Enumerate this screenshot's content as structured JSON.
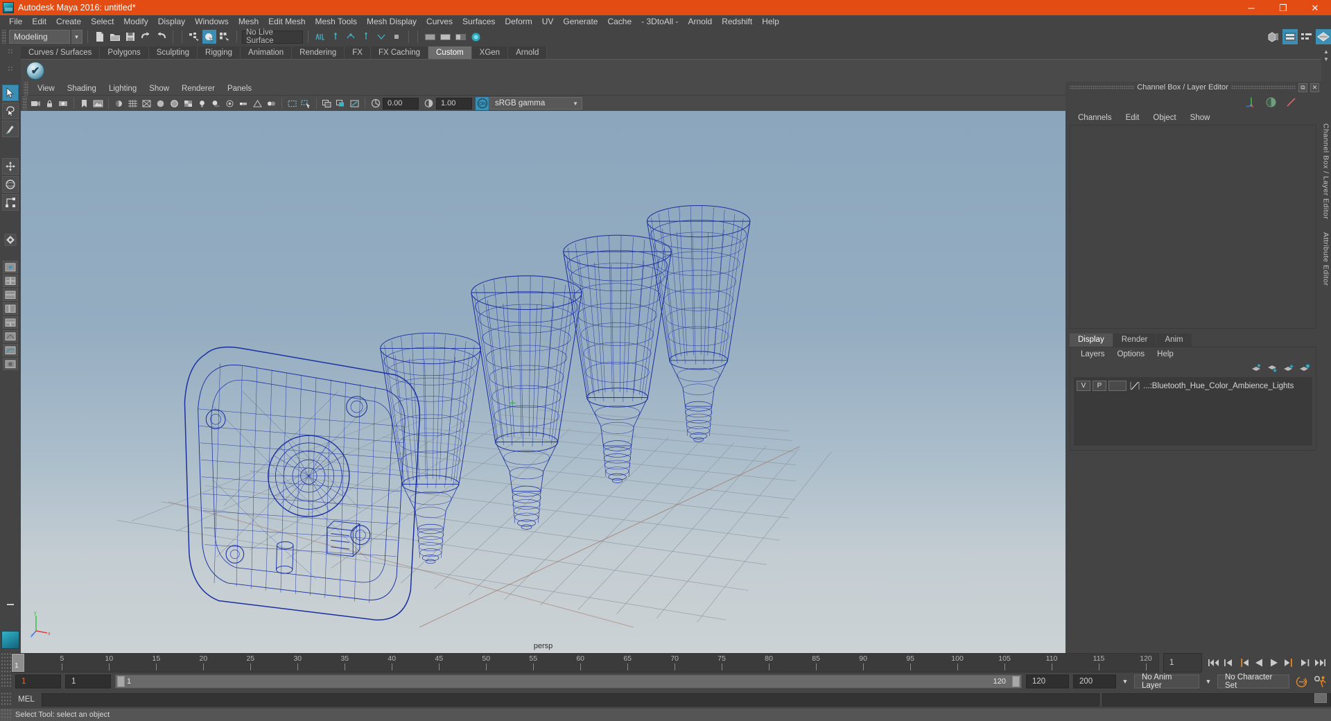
{
  "window": {
    "title": "Autodesk Maya 2016: untitled*",
    "minimize_label": "─",
    "maximize_label": "❐",
    "close_label": "✕",
    "accent_color": "#e34c12"
  },
  "menubar": {
    "items": [
      "File",
      "Edit",
      "Create",
      "Select",
      "Modify",
      "Display",
      "Windows",
      "Mesh",
      "Edit Mesh",
      "Mesh Tools",
      "Mesh Display",
      "Curves",
      "Surfaces",
      "Deform",
      "UV",
      "Generate",
      "Cache",
      "- 3DtoAll -",
      "Arnold",
      "Redshift",
      "Help"
    ]
  },
  "toolbar": {
    "menuset_value": "Modeling",
    "live_surface_value": "No Live Surface",
    "icons": [
      "new-scene-icon",
      "open-scene-icon",
      "save-scene-icon",
      "undo-icon",
      "redo-icon",
      "select-by-hierarchy-icon",
      "select-by-object-icon",
      "select-by-component-icon",
      "snap-grid-icon",
      "snap-curve-icon",
      "snap-point-icon",
      "snap-projected-icon",
      "snap-view-plane-icon",
      "make-live-icon"
    ],
    "right_icons": [
      "show-hide-modeling-toolkit-icon",
      "show-hide-attribute-editor-icon",
      "show-hide-tool-settings-icon",
      "show-hide-channel-box-icon"
    ]
  },
  "shelf": {
    "tabs": [
      "Curves / Surfaces",
      "Polygons",
      "Sculpting",
      "Rigging",
      "Animation",
      "Rendering",
      "FX",
      "FX Caching",
      "Custom",
      "XGen",
      "Arnold"
    ],
    "active_tab": "Custom",
    "item_icon": "checkmark-sphere-icon"
  },
  "toolbox": {
    "items": [
      {
        "name": "select-tool",
        "active": true
      },
      {
        "name": "lasso-select-tool",
        "active": false
      },
      {
        "name": "paint-select-tool",
        "active": false
      },
      {
        "name": "move-tool",
        "active": false
      },
      {
        "name": "rotate-tool",
        "active": false
      },
      {
        "name": "scale-tool",
        "active": false
      },
      {
        "name": "last-tool-used",
        "active": false
      }
    ],
    "layout_items": [
      "single-perspective-view-icon",
      "four-view-layout-icon",
      "two-pane-stacked-icon",
      "persp-outliner-icon",
      "hypergraph-layout-icon",
      "outliner-persp-icon",
      "persp-graph-editor-icon",
      "hypershade-persp-icon"
    ]
  },
  "viewport": {
    "menus": [
      "View",
      "Shading",
      "Lighting",
      "Show",
      "Renderer",
      "Panels"
    ],
    "camera_label": "persp",
    "exposure_value": "0.00",
    "gamma_value": "1.00",
    "color_management_toggle": "ON",
    "color_profile": "sRGB gamma",
    "toolbar_icons": [
      "select-camera-icon",
      "lock-camera-icon",
      "camera-attributes-icon",
      "bookmark-icon",
      "image-plane-icon",
      "two-sided-lighting-icon",
      "grid-toggle-icon",
      "wireframe-icon",
      "smooth-shade-all-icon",
      "shaded-wireframe-icon",
      "textured-icon",
      "use-all-lights-icon",
      "shadows-icon",
      "screen-space-ao-icon",
      "motion-blur-icon",
      "multisample-aa-icon",
      "depth-of-field-icon",
      "isolate-select-icon",
      "xray-icon",
      "xray-joints-icon",
      "xray-active-components-icon",
      "exposure-icon",
      "gamma-icon",
      "color-management-icon"
    ],
    "scene_description": "Wireframe Bluetooth Hue Color Ambience Lights — one speaker base and four bulb shades"
  },
  "channel_box": {
    "panel_title": "Channel Box / Layer Editor",
    "restore_icon": "restore-panel-icon",
    "close_icon": "close-panel-icon",
    "toolbar_icons": [
      "channel-box-icon",
      "layer-editor-icon",
      "anim-layers-icon"
    ],
    "menus": [
      "Channels",
      "Edit",
      "Object",
      "Show"
    ],
    "content": ""
  },
  "layer_editor": {
    "tabs": [
      "Display",
      "Render",
      "Anim"
    ],
    "active_tab": "Display",
    "menus": [
      "Layers",
      "Options",
      "Help"
    ],
    "buttons": [
      "move-layer-up-icon",
      "move-layer-down-icon",
      "create-new-layer-icon",
      "create-layer-from-selected-icon"
    ],
    "layers": [
      {
        "visibility": "V",
        "playback": "P",
        "shading": "",
        "color_swatch": "display-type-icon",
        "name": "...:Bluetooth_Hue_Color_Ambience_Lights"
      }
    ]
  },
  "right_strip": {
    "labels": [
      "Channel Box / Layer Editor",
      "Attribute Editor"
    ]
  },
  "timeline": {
    "start_frame": "1",
    "end_frame": "120",
    "playback_start": "1",
    "playback_end": "120",
    "range_start": "1",
    "range_end": "120",
    "anim_start": "120",
    "anim_end": "200",
    "current_frame": "1",
    "ticks": [
      5,
      10,
      15,
      20,
      25,
      30,
      35,
      40,
      45,
      50,
      55,
      60,
      65,
      70,
      75,
      80,
      85,
      90,
      95,
      100,
      105,
      110,
      115,
      120
    ],
    "playback_buttons": [
      "go-to-start-icon",
      "step-back-frame-icon",
      "step-back-key-icon",
      "play-backwards-icon",
      "play-forwards-icon",
      "step-forward-key-icon",
      "step-forward-frame-icon",
      "go-to-end-icon"
    ],
    "anim_layer_value": "No Anim Layer",
    "character_set_value": "No Character Set",
    "auto_key_icon": "auto-keyframe-toggle-icon",
    "anim_prefs_icon": "animation-preferences-icon"
  },
  "command_line": {
    "language_label": "MEL",
    "input_value": "",
    "input_placeholder": ""
  },
  "status_bar": {
    "message": "Select Tool: select an object"
  }
}
